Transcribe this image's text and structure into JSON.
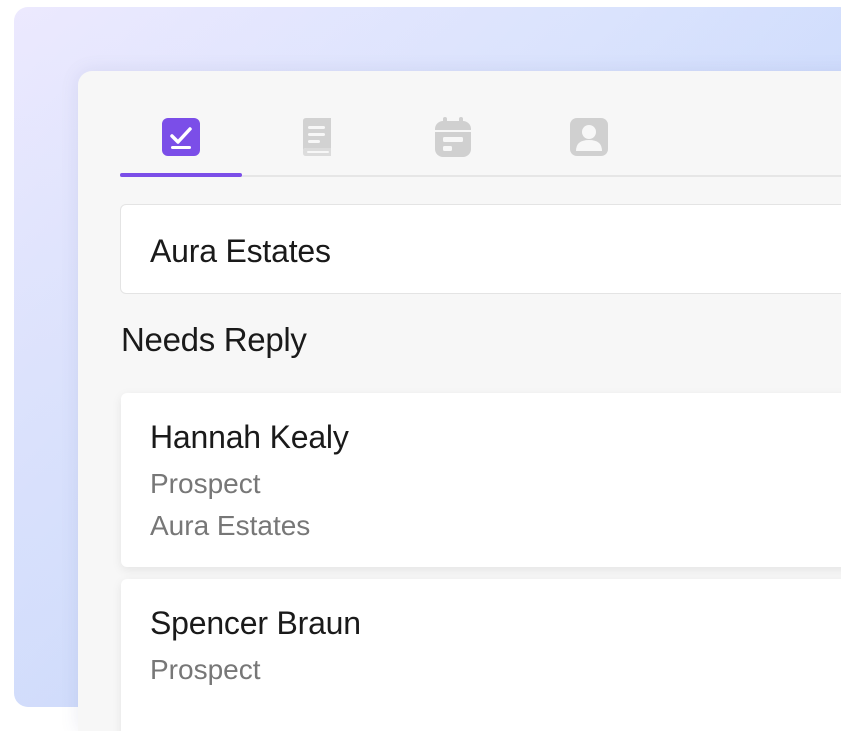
{
  "tabs": [
    {
      "icon": "checkbox-icon",
      "active": true
    },
    {
      "icon": "notebook-icon",
      "active": false
    },
    {
      "icon": "calendar-icon",
      "active": false
    },
    {
      "icon": "contact-icon",
      "active": false
    }
  ],
  "search": {
    "value": "Aura Estates"
  },
  "section": {
    "title": "Needs Reply"
  },
  "contacts": [
    {
      "name": "Hannah Kealy",
      "status": "Prospect",
      "company": "Aura Estates"
    },
    {
      "name": "Spencer Braun",
      "status": "Prospect"
    }
  ],
  "colors": {
    "accent": "#7b4ee8",
    "inactive_icon": "#d0d0d0",
    "muted_text": "#777777"
  }
}
